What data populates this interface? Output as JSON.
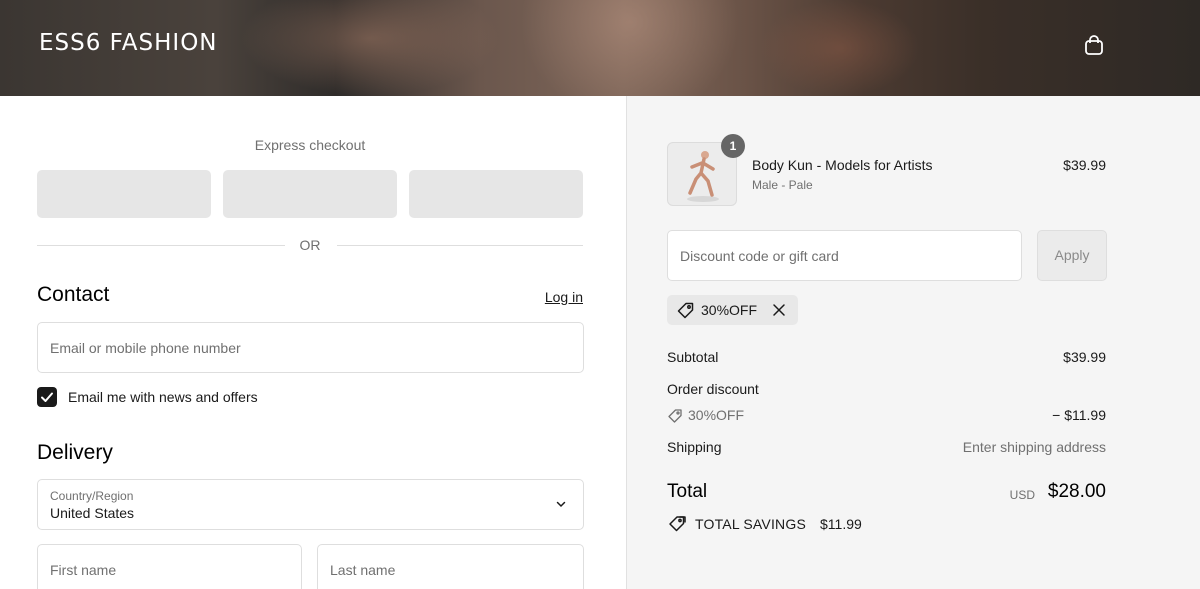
{
  "header": {
    "brand": "ESS6 FASHION",
    "cart_icon": "shopping-bag-icon"
  },
  "express": {
    "label": "Express checkout",
    "or_label": "OR"
  },
  "contact": {
    "title": "Contact",
    "login_link": "Log in",
    "email_placeholder": "Email or mobile phone number",
    "newsletter_label": "Email me with news and offers",
    "newsletter_checked": true
  },
  "delivery": {
    "title": "Delivery",
    "country_label": "Country/Region",
    "country_value": "United States",
    "first_name_placeholder": "First name",
    "last_name_placeholder": "Last name"
  },
  "summary": {
    "product": {
      "quantity": "1",
      "name": "Body Kun - Models for Artists",
      "variant": "Male - Pale",
      "price": "$39.99"
    },
    "discount_input_placeholder": "Discount code or gift card",
    "apply_label": "Apply",
    "applied_code": "30%OFF",
    "subtotal_label": "Subtotal",
    "subtotal_value": "$39.99",
    "order_discount_label": "Order discount",
    "order_discount_code": "30%OFF",
    "order_discount_value": "− $11.99",
    "shipping_label": "Shipping",
    "shipping_value": "Enter shipping address",
    "total_label": "Total",
    "currency": "USD",
    "total_value": "$28.00",
    "savings_label": "TOTAL SAVINGS",
    "savings_value": "$11.99"
  },
  "colors": {
    "summary_bg": "#f5f5f5",
    "border": "#dedede",
    "muted_text": "#707070"
  }
}
